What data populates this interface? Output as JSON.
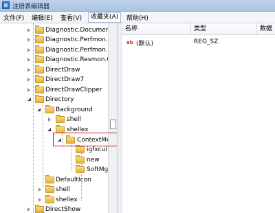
{
  "window": {
    "title": "注册表编辑器"
  },
  "menu": [
    "文件(F)",
    "编辑(E)",
    "查看(V)",
    "收藏夹(A)",
    "帮助(H)"
  ],
  "tree": {
    "items": [
      {
        "label": "Diagnostic.Document"
      },
      {
        "label": "Diagnostic.Perfmon.C"
      },
      {
        "label": "Diagnostic.Perfmon.C"
      },
      {
        "label": "Diagnostic.Resmon.C"
      },
      {
        "label": "DirectDraw"
      },
      {
        "label": "DirectDraw7"
      },
      {
        "label": "DirectDrawClipper"
      },
      {
        "label": "Directory"
      },
      {
        "label": "Background"
      },
      {
        "label": "shell"
      },
      {
        "label": "shellex"
      },
      {
        "label": "ContextMe",
        "selected": true
      },
      {
        "label": "igfxcui"
      },
      {
        "label": "new"
      },
      {
        "label": "SoftMg"
      },
      {
        "label": "DefaultIcon"
      },
      {
        "label": "shell"
      },
      {
        "label": "shellex"
      },
      {
        "label": "DirectShow"
      }
    ]
  },
  "list": {
    "columns": [
      "名称",
      "类型",
      "数据"
    ],
    "rows": [
      {
        "name": "(默认)",
        "type": "REG_SZ",
        "icon": "string-value-icon"
      }
    ]
  },
  "colors": {
    "highlight_border": "#d21b1b",
    "folder": "#e9c25a"
  }
}
